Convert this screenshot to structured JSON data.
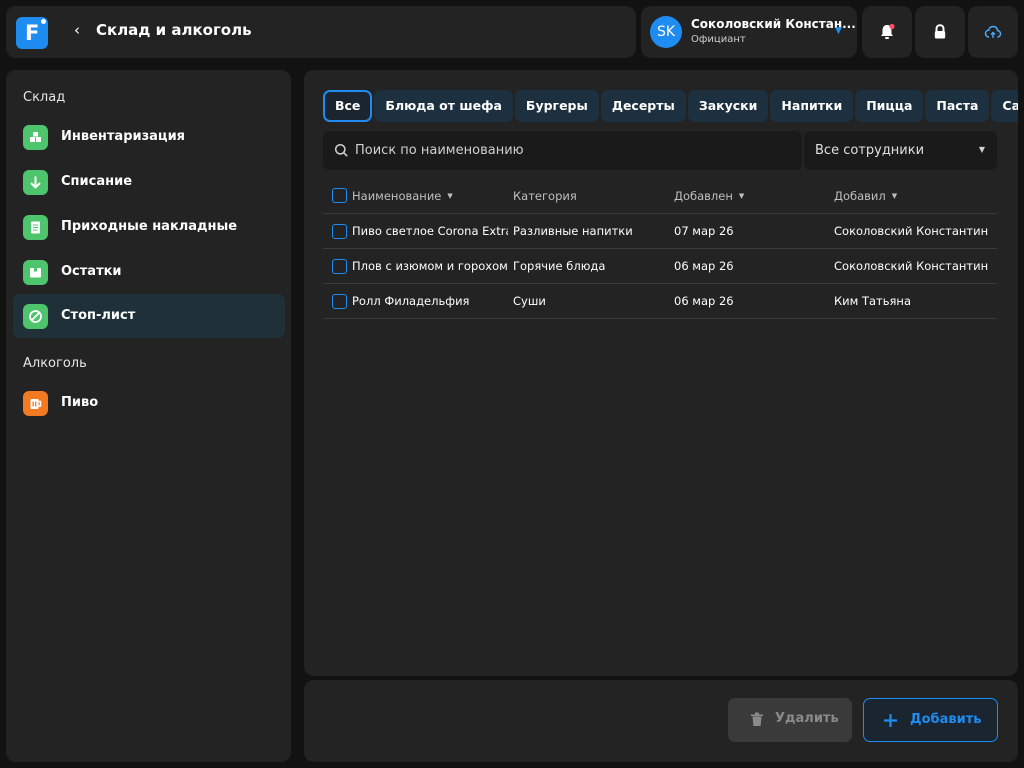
{
  "header": {
    "back_glyph": "‹",
    "title": "Склад и алкоголь"
  },
  "user": {
    "initials": "SK",
    "name": "Соколовский Констан...",
    "role": "Официант"
  },
  "sidebar": {
    "section_storage": "Склад",
    "section_alcohol": "Алкоголь",
    "items": [
      {
        "label": "Инвентаризация",
        "icon": "boxes-icon",
        "color": "#4ec46c"
      },
      {
        "label": "Списание",
        "icon": "arrow-down-icon",
        "color": "#4ec46c"
      },
      {
        "label": "Приходные накладные",
        "icon": "document-icon",
        "color": "#4ec46c"
      },
      {
        "label": "Остатки",
        "icon": "box-icon",
        "color": "#4ec46c"
      },
      {
        "label": "Стоп-лист",
        "icon": "stop-icon",
        "color": "#4ec46c",
        "active": true
      },
      {
        "label": "Пиво",
        "icon": "beer-icon",
        "color": "#f27a20"
      }
    ]
  },
  "tabs": [
    "Все",
    "Блюда от шефа",
    "Бургеры",
    "Десерты",
    "Закуски",
    "Напитки",
    "Пицца",
    "Паста",
    "Салаты"
  ],
  "search": {
    "placeholder": "Поиск по наименованию"
  },
  "staff_filter": {
    "selected": "Все сотрудники"
  },
  "table": {
    "columns": [
      "Наименование",
      "Категория",
      "Добавлен",
      "Добавил"
    ],
    "rows": [
      {
        "name": "Пиво светлое Corona Extra...",
        "category": "Разливные напитки",
        "added": "07 мар 26",
        "added_by": "Соколовский Константин"
      },
      {
        "name": "Плов с изюмом и горохом",
        "category": "Горячие блюда",
        "added": "06 мар 26",
        "added_by": "Соколовский Константин"
      },
      {
        "name": "Ролл Филадельфия",
        "category": "Суши",
        "added": "06 мар 26",
        "added_by": "Ким Татьяна"
      }
    ]
  },
  "footer": {
    "delete_label": "Удалить",
    "add_label": "Добавить"
  },
  "colors": {
    "accent": "#1e8cf0",
    "green": "#4ec46c",
    "orange": "#f27a20",
    "panel": "#232323"
  }
}
